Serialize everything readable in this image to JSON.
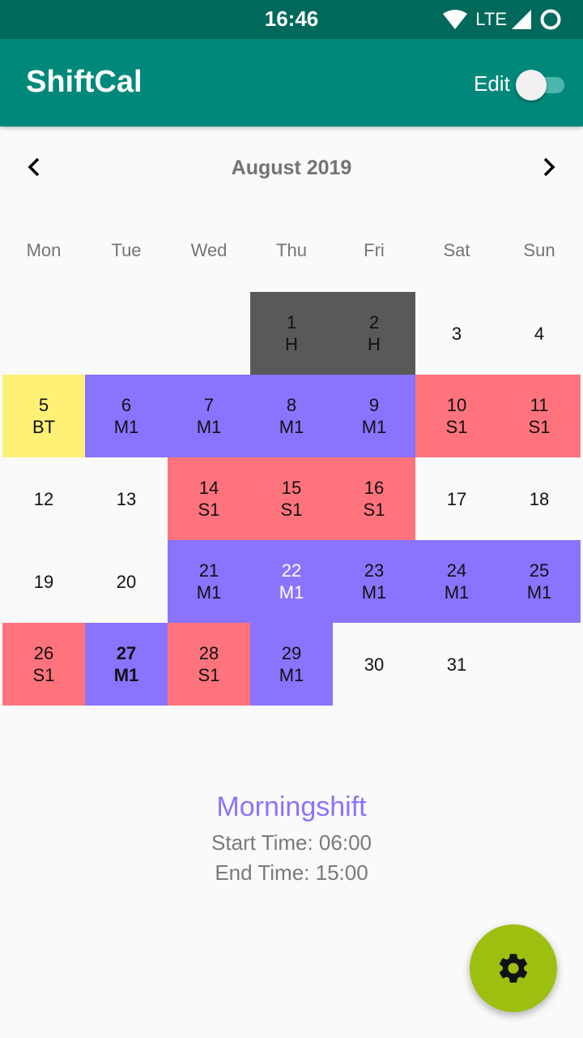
{
  "status_bar": {
    "time": "16:46",
    "network": "LTE"
  },
  "app_bar": {
    "title": "ShiftCal",
    "edit_label": "Edit",
    "edit_enabled": false
  },
  "calendar": {
    "month_label": "August 2019",
    "weekdays": [
      "Mon",
      "Tue",
      "Wed",
      "Thu",
      "Fri",
      "Sat",
      "Sun"
    ],
    "leading_blank_days": 3,
    "days": [
      {
        "day": "1",
        "shift": "H"
      },
      {
        "day": "2",
        "shift": "H"
      },
      {
        "day": "3",
        "shift": ""
      },
      {
        "day": "4",
        "shift": ""
      },
      {
        "day": "5",
        "shift": "BT"
      },
      {
        "day": "6",
        "shift": "M1"
      },
      {
        "day": "7",
        "shift": "M1"
      },
      {
        "day": "8",
        "shift": "M1"
      },
      {
        "day": "9",
        "shift": "M1"
      },
      {
        "day": "10",
        "shift": "S1"
      },
      {
        "day": "11",
        "shift": "S1"
      },
      {
        "day": "12",
        "shift": ""
      },
      {
        "day": "13",
        "shift": ""
      },
      {
        "day": "14",
        "shift": "S1"
      },
      {
        "day": "15",
        "shift": "S1"
      },
      {
        "day": "16",
        "shift": "S1"
      },
      {
        "day": "17",
        "shift": ""
      },
      {
        "day": "18",
        "shift": ""
      },
      {
        "day": "19",
        "shift": ""
      },
      {
        "day": "20",
        "shift": ""
      },
      {
        "day": "21",
        "shift": "M1"
      },
      {
        "day": "22",
        "shift": "M1",
        "white_text": true
      },
      {
        "day": "23",
        "shift": "M1"
      },
      {
        "day": "24",
        "shift": "M1"
      },
      {
        "day": "25",
        "shift": "M1"
      },
      {
        "day": "26",
        "shift": "S1"
      },
      {
        "day": "27",
        "shift": "M1",
        "today": true
      },
      {
        "day": "28",
        "shift": "S1"
      },
      {
        "day": "29",
        "shift": "M1"
      },
      {
        "day": "30",
        "shift": ""
      },
      {
        "day": "31",
        "shift": ""
      }
    ]
  },
  "shift_colors": {
    "H": "#595959",
    "BT": "#fff176",
    "M1": "#8a73ff",
    "S1": "#ff737c"
  },
  "selected_shift": {
    "name": "Morningshift",
    "start_time": "Start Time: 06:00",
    "end_time": "End Time: 15:00"
  },
  "icons": {
    "prev": "chevron-left-icon",
    "next": "chevron-right-icon",
    "fab": "gear-icon"
  },
  "colors": {
    "primary": "#00897b",
    "primary_dark": "#00695c",
    "fab": "#9dbf0f"
  }
}
